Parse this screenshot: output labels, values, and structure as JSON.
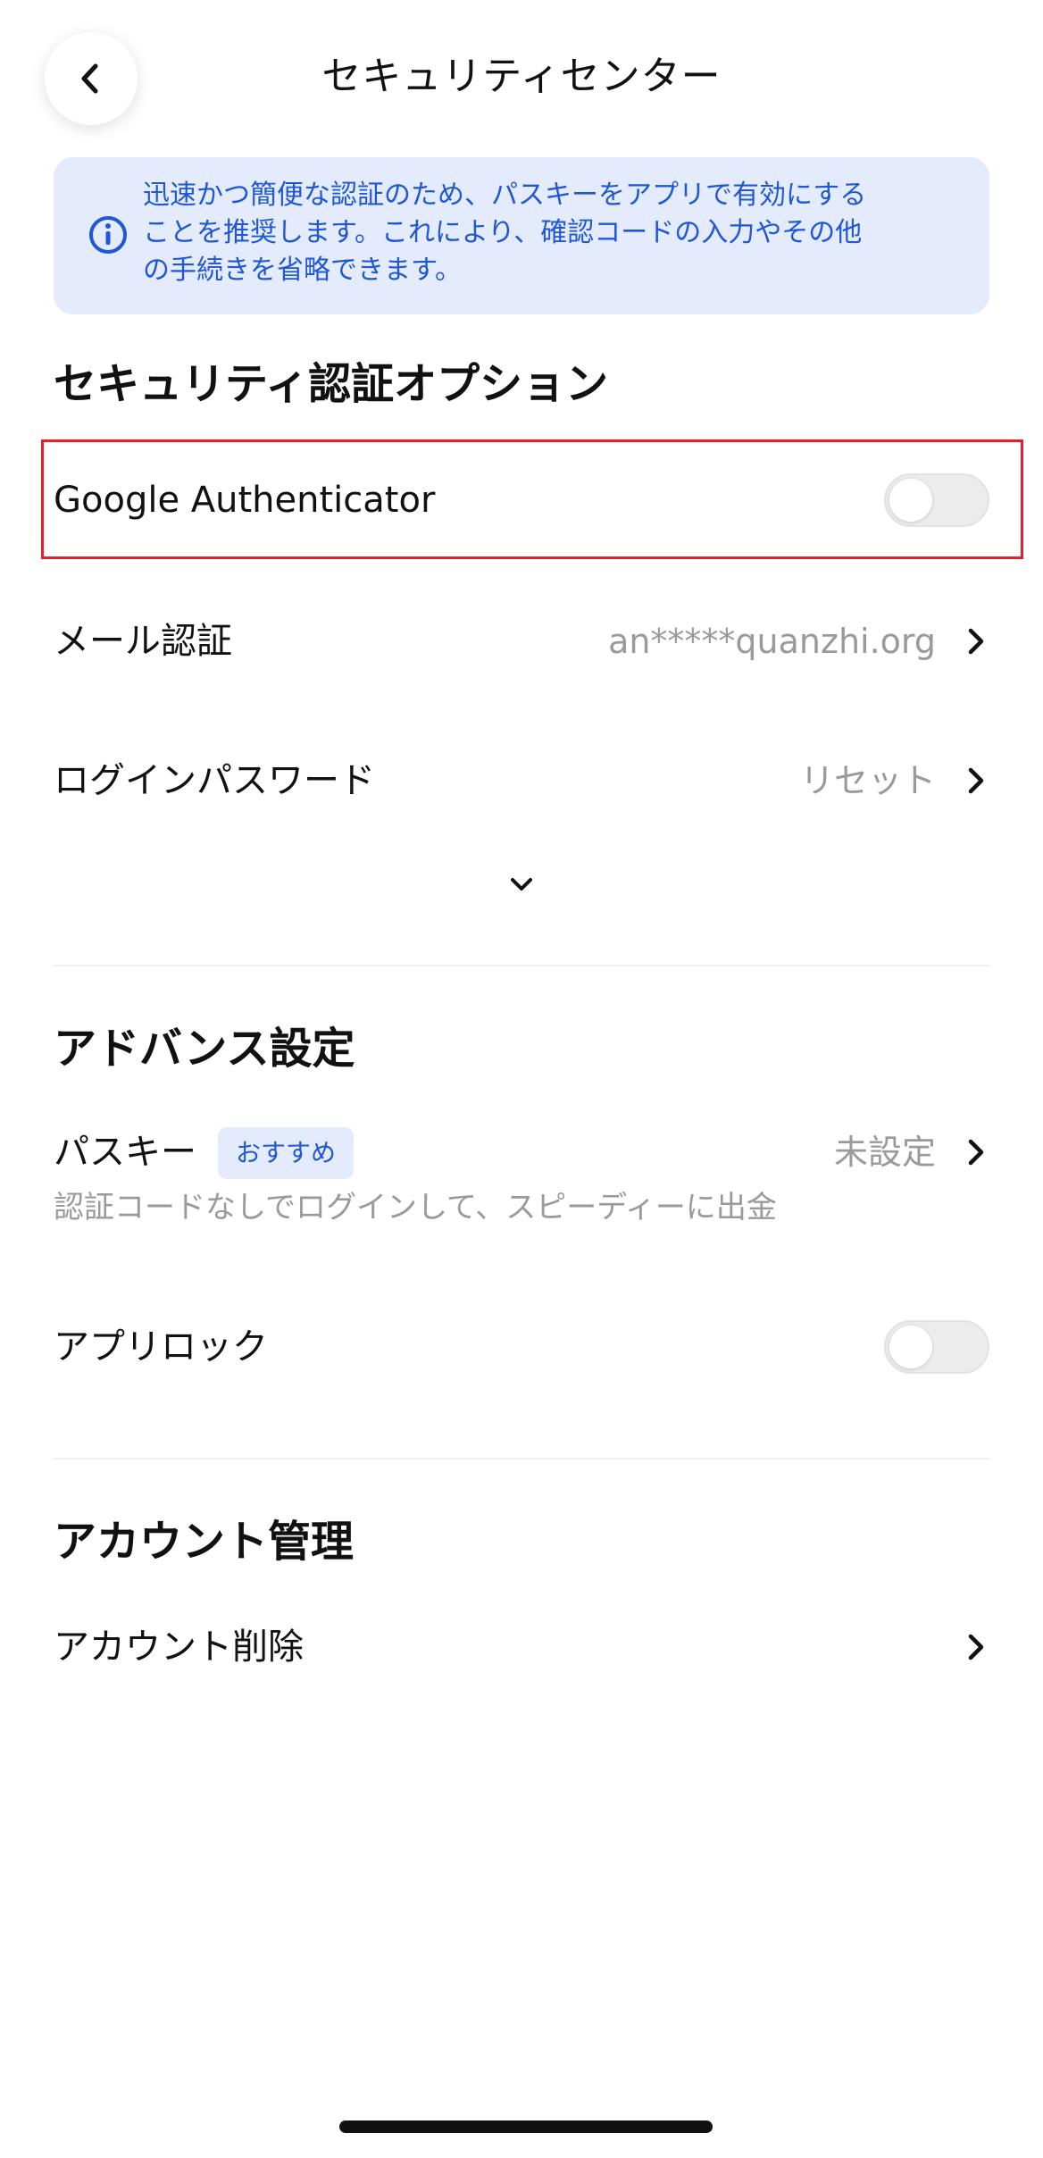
{
  "header": {
    "title": "セキュリティセンター",
    "back_icon": "chevron-left-icon"
  },
  "notice": {
    "icon": "info-circle-icon",
    "lines": [
      "迅速かつ簡便な認証のため、パスキーをアプリで有効にする",
      "ことを推奨します。これにより、確認コードの入力やその他",
      "の手続きを省略できます。"
    ],
    "color": "#1f57d6",
    "background": "#e3ebfc"
  },
  "security_options": {
    "title": "セキュリティ認証オプション",
    "google_authenticator": {
      "label": "Google Authenticator",
      "enabled": false
    },
    "email": {
      "label": "メール認証",
      "value": "an*****quanzhi.org"
    },
    "login_password": {
      "label": "ログインパスワード",
      "value": "リセット"
    },
    "expand_icon": "chevron-down-icon"
  },
  "advanced": {
    "title": "アドバンス設定",
    "passkey": {
      "label": "パスキー",
      "badge": "おすすめ",
      "value": "未設定",
      "description": "認証コードなしでログインして、スピーディーに出金"
    },
    "app_lock": {
      "label": "アプリロック",
      "enabled": false
    }
  },
  "account": {
    "title": "アカウント管理",
    "delete": {
      "label": "アカウント削除"
    }
  },
  "colors": {
    "accent": "#1f57d6",
    "highlight": "#e2202b",
    "secondary_text": "#9a9a9a"
  }
}
